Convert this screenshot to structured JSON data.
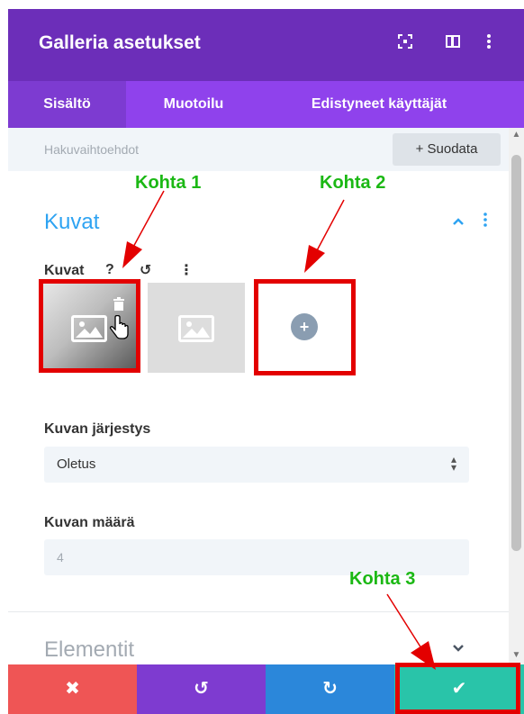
{
  "header": {
    "title": "Galleria asetukset",
    "icons": [
      "fullscreen-icon",
      "sidebar-toggle-icon",
      "more-vertical-icon"
    ]
  },
  "tabs": [
    {
      "label": "Sisältö",
      "active": true
    },
    {
      "label": "Muotoilu",
      "active": false
    },
    {
      "label": "Edistyneet käyttäjät",
      "active": false
    }
  ],
  "filter": {
    "placeholder": "Hakuvaihtoehdot",
    "button_label": "+ Suodata"
  },
  "sections": {
    "kuvat": {
      "title": "Kuvat",
      "gallery_label": "Kuvat",
      "help_glyph": "?",
      "reset_glyph": "↺",
      "more_glyph": "⋮",
      "add_glyph": "+"
    },
    "elementit": {
      "title": "Elementit"
    }
  },
  "fields": {
    "order": {
      "label": "Kuvan järjestys",
      "value": "Oletus"
    },
    "count": {
      "label": "Kuvan määrä",
      "value": "4"
    }
  },
  "footer": {
    "cancel": "✖",
    "undo": "↺",
    "redo": "↻",
    "save": "✔",
    "colors": {
      "cancel": "#ef5555",
      "undo": "#7e3bd0",
      "redo": "#2b87da",
      "save": "#29c4a9"
    }
  },
  "annotations": {
    "k1": "Kohta 1",
    "k2": "Kohta 2",
    "k3": "Kohta 3",
    "color": "#1bb814",
    "box_color": "#e30000"
  }
}
